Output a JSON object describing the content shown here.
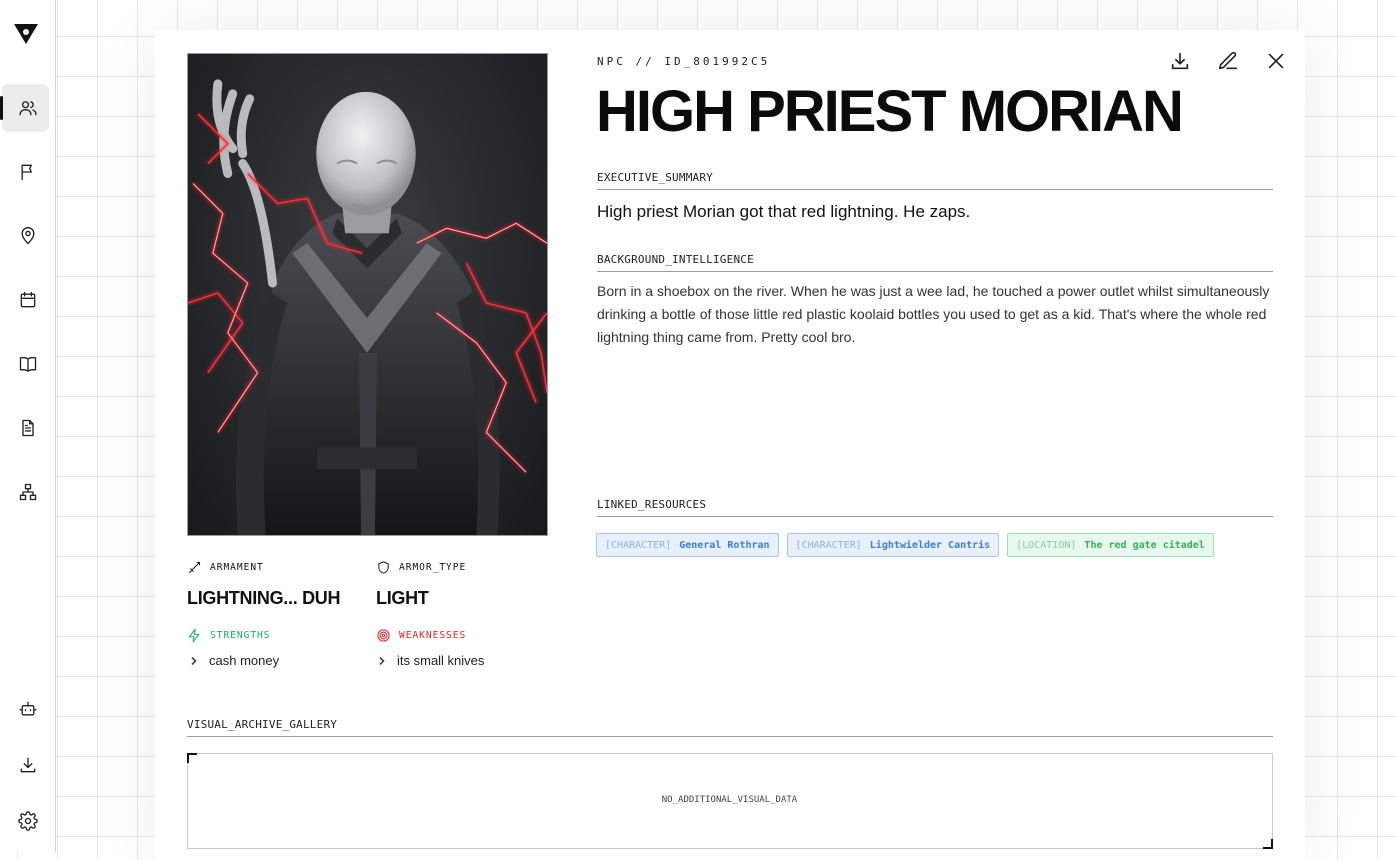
{
  "sidebar": {
    "logo_icon": "logo-triangle-icon",
    "nav": [
      {
        "name": "characters",
        "icon": "users-icon",
        "active": true
      },
      {
        "name": "factions",
        "icon": "flag-icon"
      },
      {
        "name": "locations",
        "icon": "map-pin-icon"
      },
      {
        "name": "timeline",
        "icon": "calendar-icon"
      },
      {
        "name": "lore",
        "icon": "book-icon"
      },
      {
        "name": "documents",
        "icon": "file-text-icon"
      },
      {
        "name": "hierarchy",
        "icon": "network-icon"
      }
    ],
    "bottom": [
      {
        "name": "assistant",
        "icon": "bot-icon"
      },
      {
        "name": "export",
        "icon": "download-icon"
      },
      {
        "name": "settings",
        "icon": "gear-icon"
      }
    ]
  },
  "toolbar": {
    "actions": [
      "download-icon",
      "edit-icon",
      "close-icon"
    ]
  },
  "entity": {
    "id_line": "NPC // ID_801992C5",
    "name": "HIGH PRIEST MORIAN",
    "summary_label": "EXECUTIVE_SUMMARY",
    "summary": "High priest Morian got that red lightning. He zaps.",
    "background_label": "BACKGROUND_INTELLIGENCE",
    "background": "Born in a shoebox on the river. When he was just a wee lad, he touched a power outlet whilst simultaneously drinking a bottle of those little red plastic koolaid bottles you used to get as a kid. That's where the whole red lightning thing came from. Pretty cool bro.",
    "linked_label": "LINKED_RESOURCES",
    "linked": [
      {
        "type": "[CHARACTER]",
        "name": "General Rothran",
        "kind": "character"
      },
      {
        "type": "[CHARACTER]",
        "name": "Lightwielder Cantris",
        "kind": "character"
      },
      {
        "type": "[LOCATION]",
        "name": "The red gate citadel",
        "kind": "location"
      }
    ]
  },
  "stats": {
    "armament_label": "ARMAMENT",
    "armament": "LIGHTNING... DUH",
    "armor_label": "ARMOR_TYPE",
    "armor": "LIGHT",
    "strengths_label": "STRENGTHS",
    "strengths": [
      "cash money"
    ],
    "weaknesses_label": "WEAKNESSES",
    "weaknesses": [
      "its small knives"
    ]
  },
  "gallery": {
    "label": "VISUAL_ARCHIVE_GALLERY",
    "empty": "NO_ADDITIONAL_VISUAL_DATA"
  },
  "colors": {
    "strength": "#16b35a",
    "weakness": "#e0262e",
    "character_chip": "#3a7fd8",
    "location_chip": "#2fb35a"
  }
}
